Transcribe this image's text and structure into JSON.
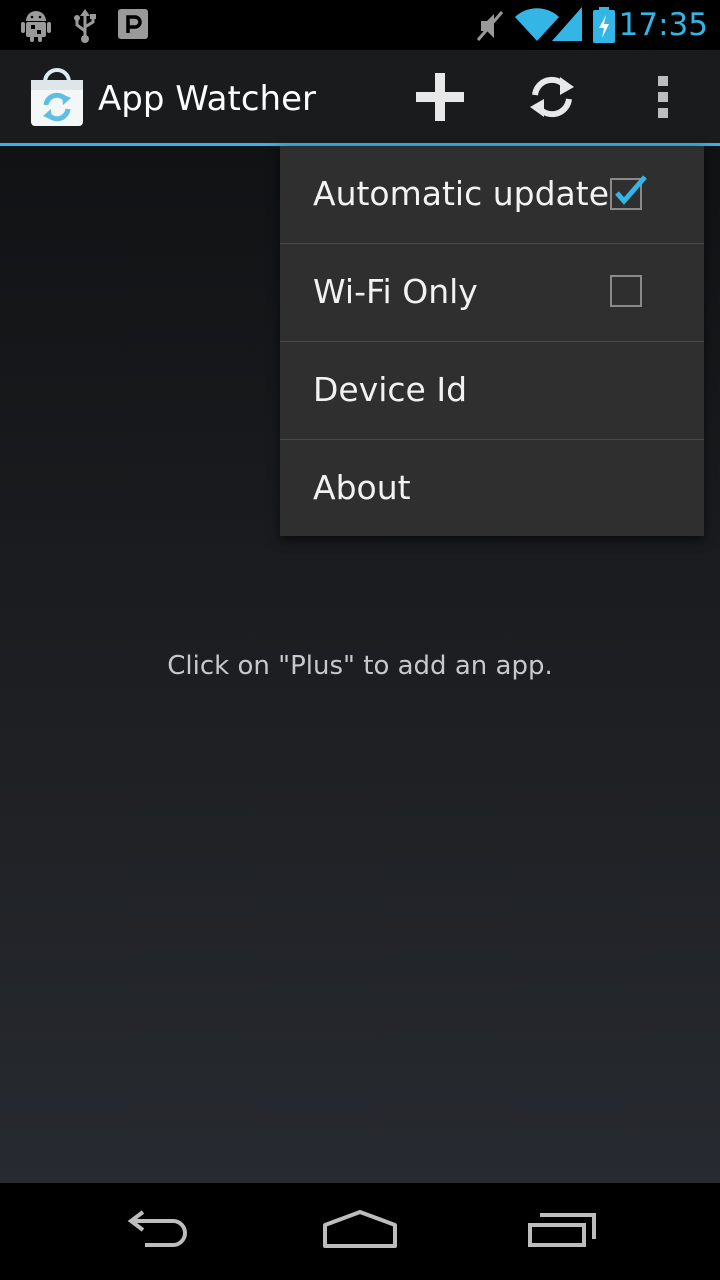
{
  "status_bar": {
    "time": "17:35",
    "icons": [
      "android-debug-icon",
      "usb-icon",
      "parking-icon",
      "mute-icon",
      "wifi-icon",
      "signal-icon",
      "battery-charging-icon"
    ]
  },
  "action_bar": {
    "title": "App Watcher",
    "app_icon": "shopping-bag-sync-icon",
    "actions": [
      "add-icon",
      "refresh-icon",
      "overflow-menu-icon"
    ]
  },
  "main": {
    "empty_message": "Click on \"Plus\" to add an app."
  },
  "menu": {
    "items": [
      {
        "label": "Automatic update",
        "checkbox": true,
        "checked": true
      },
      {
        "label": "Wi-Fi Only",
        "checkbox": true,
        "checked": false
      },
      {
        "label": "Device Id"
      },
      {
        "label": "About"
      }
    ]
  },
  "nav_bar": {
    "buttons": [
      "back-icon",
      "home-icon",
      "recent-apps-icon"
    ]
  },
  "colors": {
    "accent": "#33b5e5",
    "action_bar": "#1a1b1d",
    "menu_bg": "#2f2f30"
  }
}
